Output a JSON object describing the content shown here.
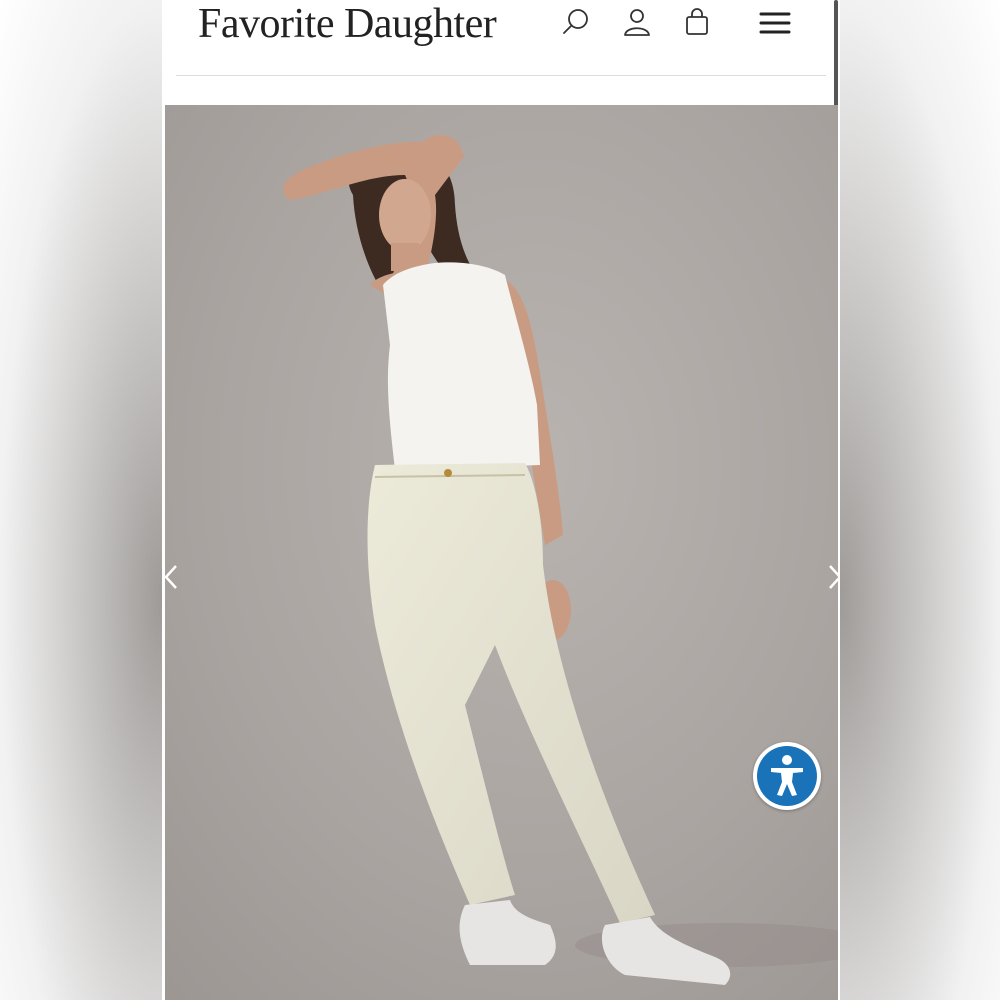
{
  "header": {
    "logo_text": "Favorite Daughter",
    "icons": [
      "search-icon",
      "account-icon",
      "shopping-bag-icon",
      "hamburger-menu-icon"
    ]
  },
  "carousel": {
    "prev_icon": "chevron-left-icon",
    "next_icon": "chevron-right-icon"
  },
  "accessibility": {
    "icon": "accessibility-person-icon",
    "color": "#1a73b9"
  },
  "colors": {
    "background": "#ffffff",
    "text": "#222222",
    "hero_backdrop": "#b1aba8"
  }
}
